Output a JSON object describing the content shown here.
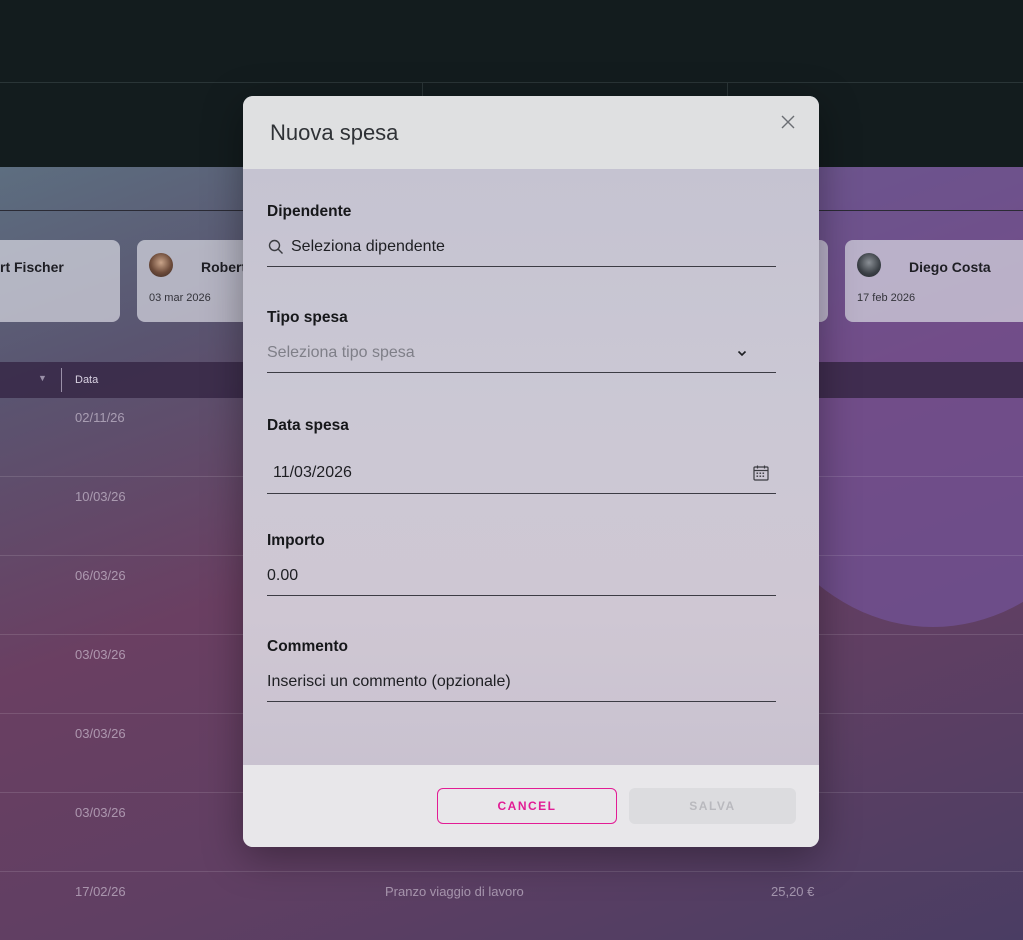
{
  "background": {
    "cards": [
      {
        "name": "rt Fischer",
        "date": ""
      },
      {
        "name": "Robert",
        "date": "03 mar 2026"
      },
      {
        "name": "Diego Costa",
        "date": "17 feb 2026"
      }
    ],
    "table": {
      "date_header": "Data",
      "rows": [
        {
          "date": "02/11/26",
          "description": "",
          "amount": ""
        },
        {
          "date": "10/03/26",
          "description": "",
          "amount": ""
        },
        {
          "date": "06/03/26",
          "description": "",
          "amount": ""
        },
        {
          "date": "03/03/26",
          "description": "",
          "amount": ""
        },
        {
          "date": "03/03/26",
          "description": "",
          "amount": ""
        },
        {
          "date": "03/03/26",
          "description": "",
          "amount": ""
        },
        {
          "date": "17/02/26",
          "description": "Pranzo viaggio di lavoro",
          "amount": "25,20 €"
        }
      ]
    }
  },
  "dialog": {
    "title": "Nuova spesa",
    "fields": {
      "employee": {
        "label": "Dipendente",
        "value": "Seleziona dipendente"
      },
      "type": {
        "label": "Tipo spesa",
        "placeholder": "Seleziona tipo spesa"
      },
      "date": {
        "label": "Data spesa",
        "value": "11/03/2026"
      },
      "amount": {
        "label": "Importo",
        "value": "0.00"
      },
      "comment": {
        "label": "Commento",
        "value": "Inserisci un commento (opzionale)"
      }
    },
    "buttons": {
      "cancel": "CANCEL",
      "save": "SALVA"
    },
    "accent_color": "#e21c95"
  }
}
